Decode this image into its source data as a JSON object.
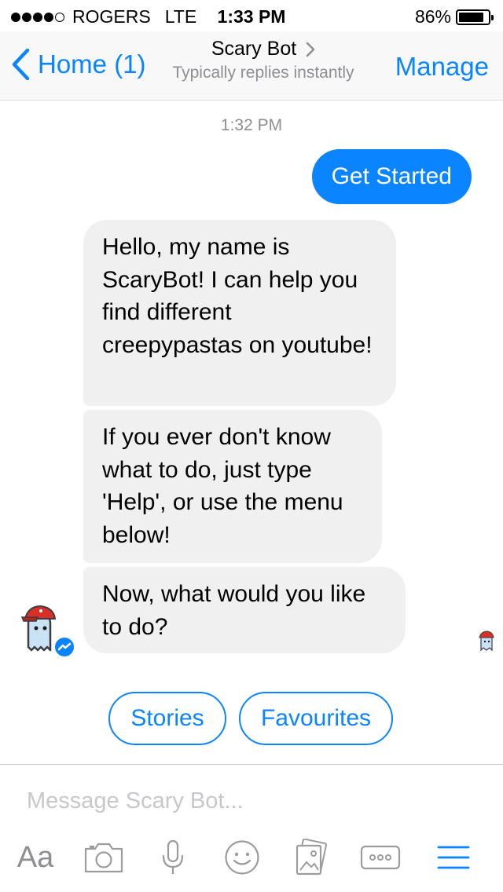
{
  "status_bar": {
    "carrier": "ROGERS",
    "network": "LTE",
    "time": "1:33 PM",
    "battery": "86%",
    "battery_level": 0.86,
    "signal_bars_filled": 4,
    "signal_bars_total": 5
  },
  "nav": {
    "back_label": "Home (1)",
    "title": "Scary Bot",
    "subtitle": "Typically replies instantly",
    "manage_label": "Manage"
  },
  "chat": {
    "timestamp": "1:32 PM",
    "outgoing": [
      {
        "text": "Get Started"
      }
    ],
    "incoming": [
      {
        "text": "Hello, my name is ScaryBot! I can help you find different creepypastas on youtube!"
      },
      {
        "text": "If you ever don't know what to do, just type 'Help', or use the menu below!"
      },
      {
        "text": "Now, what would you like to do?"
      }
    ]
  },
  "quick_replies": [
    {
      "label": "Stories"
    },
    {
      "label": "Favourites"
    }
  ],
  "composer": {
    "placeholder": "Message Scary Bot...",
    "value": "",
    "aa_label": "Aa",
    "tools": [
      "text-format-icon",
      "camera-icon",
      "microphone-icon",
      "emoji-icon",
      "gallery-icon",
      "more-icon",
      "menu-icon"
    ]
  },
  "colors": {
    "accent": "#0b84ff",
    "incoming_bubble": "#f0f0f0",
    "muted_text": "#8e8e93",
    "placeholder": "#c7c7cc",
    "toolbar_icon": "#9b9ba0"
  }
}
